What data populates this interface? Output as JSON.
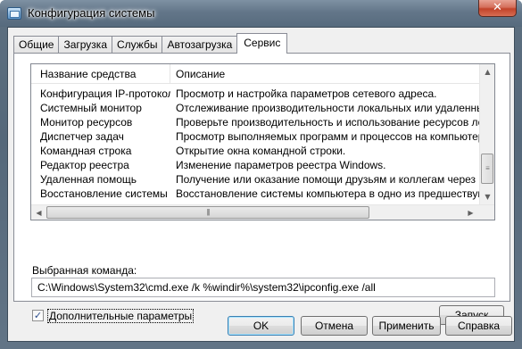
{
  "window": {
    "title": "Конфигурация системы",
    "close_glyph": "✕"
  },
  "tabs": [
    {
      "label": "Общие",
      "active": false
    },
    {
      "label": "Загрузка",
      "active": false
    },
    {
      "label": "Службы",
      "active": false
    },
    {
      "label": "Автозагрузка",
      "active": false
    },
    {
      "label": "Сервис",
      "active": true
    }
  ],
  "tools": {
    "columns": [
      "Название средства",
      "Описание"
    ],
    "rows": [
      [
        "Конфигурация IP-протокола",
        "Просмотр и настройка параметров сетевого адреса."
      ],
      [
        "Системный монитор",
        "Отслеживание производительности локальных или удаленных комп"
      ],
      [
        "Монитор ресурсов",
        "Проверьте производительность и использование ресурсов локальн"
      ],
      [
        "Диспетчер задач",
        "Просмотр выполняемых программ и процессов на компьютере."
      ],
      [
        "Командная строка",
        "Открытие окна командной строки."
      ],
      [
        "Редактор реестра",
        "Изменение параметров реестра Windows."
      ],
      [
        "Удаленная помощь",
        "Получение или оказание помощи друзьям и коллегам через Интерн"
      ],
      [
        "Восстановление системы",
        "Восстановление системы компьютера в одно из предшествующих с"
      ]
    ]
  },
  "command": {
    "label": "Выбранная команда:",
    "value": "C:\\Windows\\System32\\cmd.exe /k %windir%\\system32\\ipconfig.exe /all"
  },
  "advanced": {
    "label": "Дополнительные параметры",
    "checked": true,
    "check_glyph": "✓"
  },
  "buttons": {
    "launch": "Запуск",
    "ok": "OK",
    "cancel": "Отмена",
    "apply": "Применить",
    "help": "Справка"
  },
  "colors": {
    "title_bar": "#637689",
    "close_button": "#c2432a",
    "default_button_border": "#3c7fb1"
  }
}
